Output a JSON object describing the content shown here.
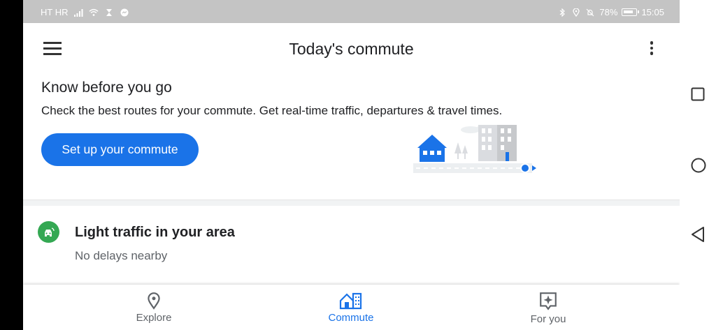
{
  "status_bar": {
    "carrier": "HT HR",
    "battery_percent": "78%",
    "time": "15:05"
  },
  "app_bar": {
    "title": "Today's commute"
  },
  "setup_card": {
    "title": "Know before you go",
    "description": "Check the best routes for your commute. Get real-time traffic, departures & travel times.",
    "button_label": "Set up your commute"
  },
  "traffic_card": {
    "title": "Light traffic in your area",
    "subtitle": "No delays nearby"
  },
  "bottom_nav": {
    "items": [
      {
        "label": "Explore",
        "icon": "location-pin-icon"
      },
      {
        "label": "Commute",
        "icon": "commute-icon"
      },
      {
        "label": "For you",
        "icon": "sparkle-icon"
      }
    ],
    "active": "Commute"
  },
  "colors": {
    "accent": "#1a73e8",
    "traffic_green": "#34a853",
    "status_bar_bg": "#c4c4c4"
  }
}
